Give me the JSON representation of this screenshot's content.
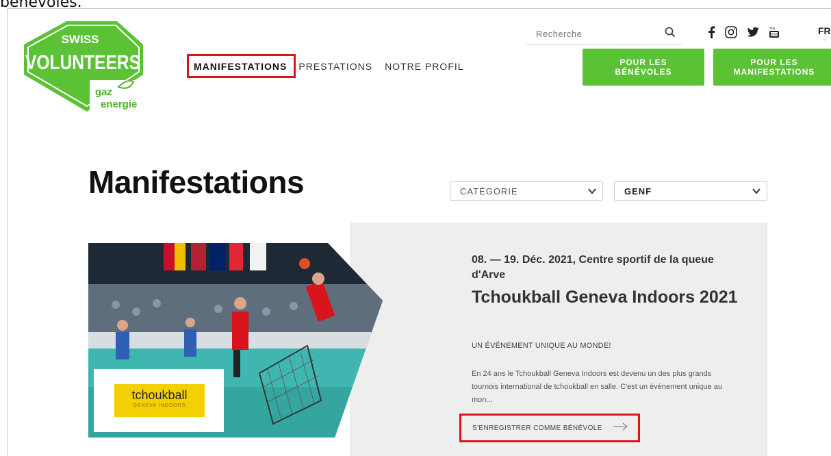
{
  "caption": "bénévoles.",
  "logo": {
    "line1": "SWISS",
    "line2": "VOLUNTEERS",
    "sponsor1": "gaz",
    "sponsor2": "energie"
  },
  "nav": {
    "item1": "MANIFESTATIONS",
    "item2": "PRESTATIONS",
    "item3": "NOTRE PROFIL"
  },
  "search": {
    "placeholder": "Recherche",
    "icon": "search-icon"
  },
  "social": [
    "facebook-icon",
    "instagram-icon",
    "twitter-icon",
    "youtube-icon"
  ],
  "lang": "FR",
  "cta": {
    "volunteers": "POUR LES BÉNÉVOLES",
    "events": "POUR LES MANIFESTATIONS"
  },
  "page_title": "Manifestations",
  "filters": {
    "category": "CATÉGORIE",
    "location": "GENF"
  },
  "event": {
    "date": "08. — 19. Déc. 2021, Centre sportif de la queue d'Arve",
    "title": "Tchoukball Geneva Indoors 2021",
    "subtitle": "UN ÉVÉNEMENT UNIQUE AU MONDE!",
    "description": "En 24 ans le Tchoukball Geneva Indoors est devenu un des plus grands tournois international de tchoukball en salle. C'est un événement unique au mon...",
    "register_label": "S'ENREGISTRER COMME BÉNÉVOLE",
    "badge_main": "tchoukball",
    "badge_sub": "GENEVA INDOORS"
  },
  "colors": {
    "brand_green": "#5bc236",
    "highlight_red": "#d8151c",
    "card_bg": "#eeeeee"
  }
}
